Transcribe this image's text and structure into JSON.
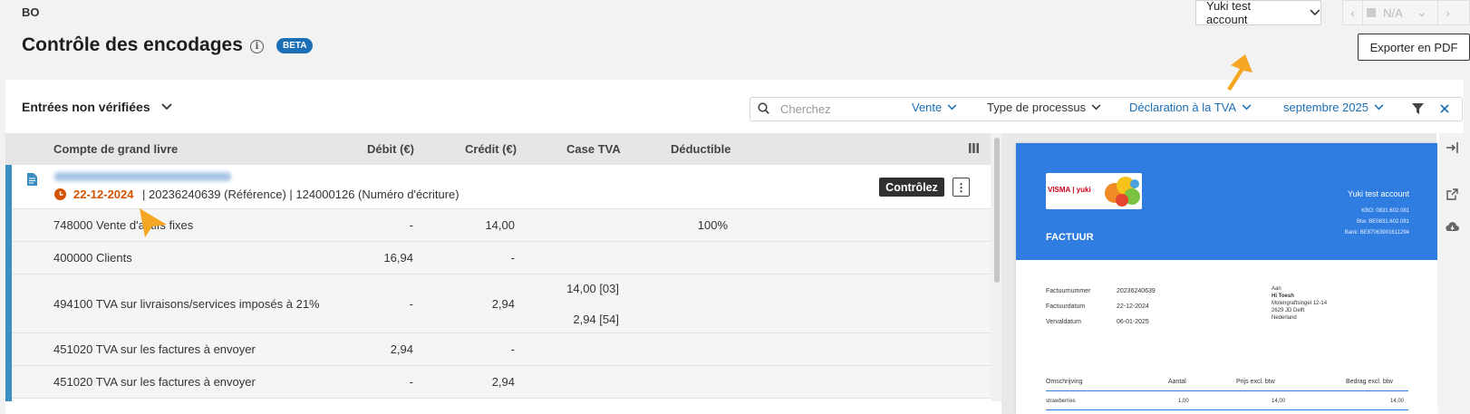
{
  "header": {
    "company": "BO",
    "account_label": "Yuki test account",
    "pager_label": "N/A",
    "title": "Contrôle des encodages",
    "beta": "BETA",
    "export_label": "Exporter en PDF"
  },
  "filters": {
    "view_label": "Entrées non vérifiées",
    "search_placeholder": "Cherchez",
    "type": "Vente",
    "process": "Type de processus",
    "declaration": "Déclaration à la TVA",
    "period": "septembre 2025"
  },
  "table": {
    "headers": {
      "account": "Compte de grand livre",
      "debit": "Débit (€)",
      "credit": "Crédit (€)",
      "vat_box": "Case TVA",
      "deductible": "Déductible"
    },
    "entry": {
      "date": "22-12-2024",
      "details": "| 20236240639 (Référence) | 124000126 (Numéro d'écriture)",
      "action_label": "Contrôlez"
    },
    "rows": [
      {
        "account": "748000 Vente d'actifs fixes",
        "debit": "-",
        "credit": "14,00",
        "vat": "",
        "vat2": "",
        "deductible": "100%"
      },
      {
        "account": "400000 Clients",
        "debit": "16,94",
        "credit": "-",
        "vat": "",
        "vat2": "",
        "deductible": ""
      },
      {
        "account": "494100 TVA sur livraisons/services imposés à 21%",
        "debit": "-",
        "credit": "2,94",
        "vat": "14,00 [03]",
        "vat2": "2,94 [54]",
        "deductible": ""
      },
      {
        "account": "451020 TVA sur les factures à envoyer",
        "debit": "2,94",
        "credit": "-",
        "vat": "",
        "vat2": "",
        "deductible": ""
      },
      {
        "account": "451020 TVA sur les factures à envoyer",
        "debit": "-",
        "credit": "2,94",
        "vat": "",
        "vat2": "",
        "deductible": ""
      }
    ]
  },
  "invoice": {
    "company": "Yuki test account",
    "kbo": "KBO:   0831.602.081",
    "btw": "Btw:   BE0831.602.081",
    "bank": "Bank:   BE87063901611294",
    "heading": "FACTUUR",
    "number_label": "Factuurnummer",
    "number": "20236240639",
    "date_label": "Factuurdatum",
    "date": "22-12-2024",
    "due_label": "Vervaldatum",
    "due": "06-01-2025",
    "to_label": "Aan",
    "to_name": "Hi Toesh",
    "to_street": "Molengraftsingel 12-14",
    "to_city": "2629 JD Delft",
    "to_country": "Nederland",
    "col_desc": "Omschrijving",
    "col_qty": "Aantal",
    "col_price": "Prijs excl. btw",
    "col_amount": "Bedrag excl. btw",
    "line_desc": "strawberries",
    "line_qty": "1,00",
    "line_price": "14,00",
    "line_amount": "14,00",
    "logo_text": "VISMA | yuki"
  },
  "colors": {
    "accent": "#3a8fc0",
    "link": "#1a6fb5",
    "date": "#d35400",
    "invoice_header": "#2f7de1",
    "pointer": "#f5a623"
  }
}
